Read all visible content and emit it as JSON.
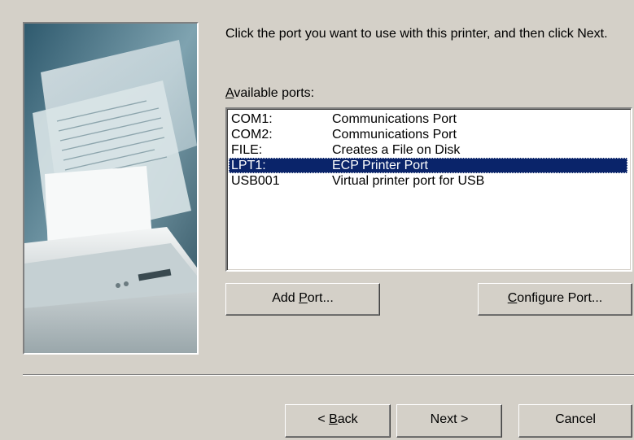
{
  "instruction": "Click the port you want to use with this printer, and then click Next.",
  "ports_label": {
    "accel": "A",
    "rest": "vailable ports:"
  },
  "ports": [
    {
      "port": "COM1:",
      "description": "Communications Port",
      "selected": false
    },
    {
      "port": "COM2:",
      "description": "Communications Port",
      "selected": false
    },
    {
      "port": "FILE:",
      "description": "Creates a File on Disk",
      "selected": false
    },
    {
      "port": "LPT1:",
      "description": "ECP Printer Port",
      "selected": true
    },
    {
      "port": "USB001",
      "description": "Virtual printer port for USB",
      "selected": false
    }
  ],
  "buttons": {
    "add_port": {
      "before": "Add ",
      "accel": "P",
      "after": "ort..."
    },
    "configure_port": {
      "before": "",
      "accel": "C",
      "after": "onfigure Port..."
    },
    "back": {
      "before": "< ",
      "accel": "B",
      "after": "ack"
    },
    "next": "Next >",
    "cancel": "Cancel"
  },
  "colors": {
    "dialog_bg": "#d4d0c8",
    "selection_bg": "#0a246a",
    "selection_text": "#ffffff"
  }
}
